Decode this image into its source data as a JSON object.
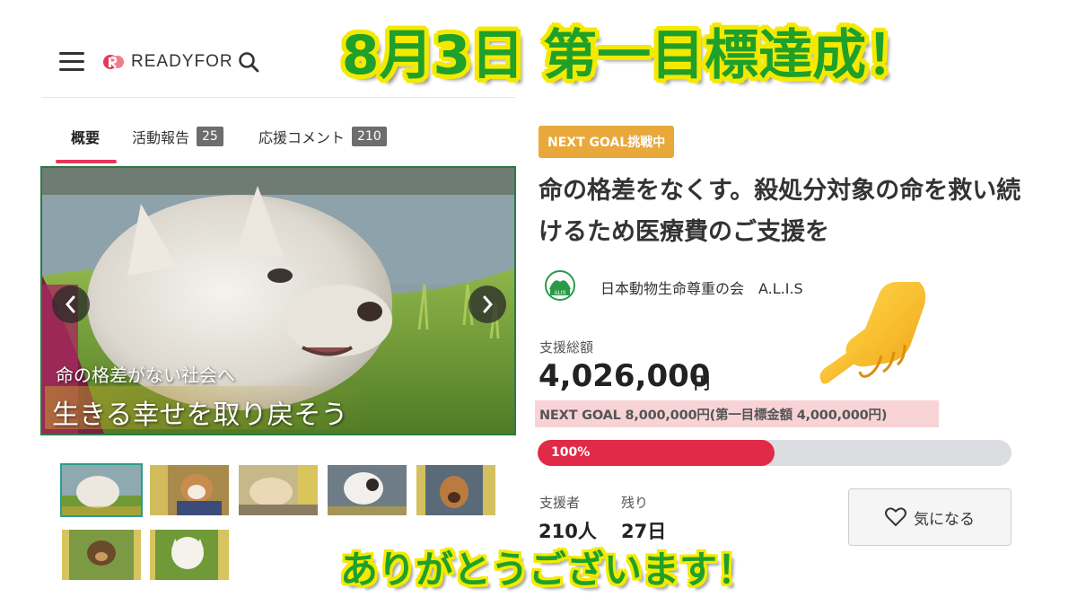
{
  "header": {
    "logo_text": "READYFOR"
  },
  "banner": {
    "text": "8月3日 第一目標達成！"
  },
  "tabs": [
    {
      "label": "概要",
      "badge": null
    },
    {
      "label": "活動報告",
      "badge": "25"
    },
    {
      "label": "応援コメント",
      "badge": "210"
    }
  ],
  "gallery": {
    "caption_line1": "命の格差がない社会へ",
    "caption_line2": "生きる幸せを取り戻そう",
    "thumbnail_count": 7
  },
  "project": {
    "status_badge": "NEXT GOAL挑戦中",
    "title": "命の格差をなくす。殺処分対象の命を救い続けるため医療費のご支援を",
    "organization": "日本動物生命尊重の会　A.L.I.S",
    "amount_label": "支援総額",
    "amount": "4,026,000",
    "amount_unit": "円",
    "next_goal_text": "NEXT GOAL 8,000,000円(第一目標金額 4,000,000円)",
    "progress_label": "100%",
    "progress_fraction": 0.5,
    "supporters_label": "支援者",
    "supporters_value": "210人",
    "remaining_label": "残り",
    "remaining_value": "27日",
    "favorite_label": "気になる"
  },
  "thanks": {
    "text": "ありがとうございます！"
  },
  "colors": {
    "brand_red": "#e02a48",
    "badge_orange": "#e9a83a",
    "banner_green": "#1fa02a",
    "banner_outline": "#f4ea00",
    "highlight_pink": "#f8d3d6"
  },
  "icons": [
    "hamburger-menu-icon",
    "search-icon",
    "chevron-left-icon",
    "chevron-right-icon",
    "heart-icon",
    "pointing-hand-icon",
    "organization-logo-icon"
  ]
}
